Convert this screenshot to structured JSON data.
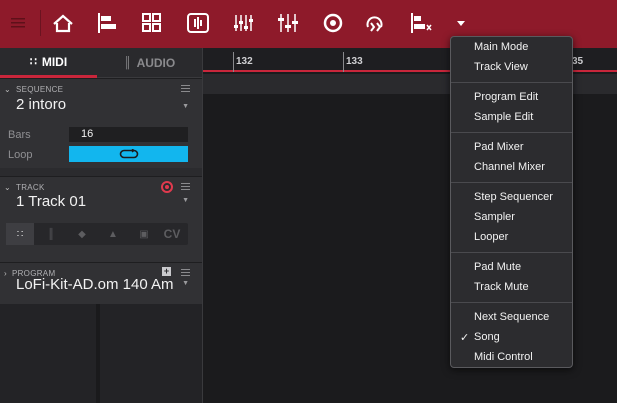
{
  "toolbar": {
    "icons": [
      "menu-icon",
      "home-icon",
      "main-mode-icon",
      "grid-icon",
      "sample-edit-icon",
      "mixer-icon",
      "channel-mixer-icon",
      "record-disc-icon",
      "looper-icon",
      "step-sequencer-icon",
      "more-caret-icon"
    ]
  },
  "tabs": {
    "midi": "MIDI",
    "audio": "AUDIO"
  },
  "sequence": {
    "heading": "SEQUENCE",
    "value": "2 intoro",
    "bars_label": "Bars",
    "bars_value": "16",
    "loop_label": "Loop"
  },
  "track": {
    "heading": "TRACK",
    "value": "1 Track 01",
    "cv_label": "CV"
  },
  "program": {
    "heading": "PROGRAM",
    "value": "LoFi-Kit-AD.om 140 Am"
  },
  "timeline": {
    "bars": [
      "132",
      "133",
      "35"
    ]
  },
  "menu": {
    "groups": [
      [
        "Main Mode",
        "Track View"
      ],
      [
        "Program Edit",
        "Sample Edit"
      ],
      [
        "Pad Mixer",
        "Channel Mixer"
      ],
      [
        "Step Sequencer",
        "Sampler",
        "Looper"
      ],
      [
        "Pad Mute",
        "Track Mute"
      ],
      [
        "Next Sequence",
        "Song",
        "Midi Control"
      ]
    ],
    "checked_item": "Song"
  },
  "colors": {
    "toolbar": "#8e1a2a",
    "accent": "#c9263b",
    "loop": "#12b6ee",
    "record": "#e03a4e"
  }
}
